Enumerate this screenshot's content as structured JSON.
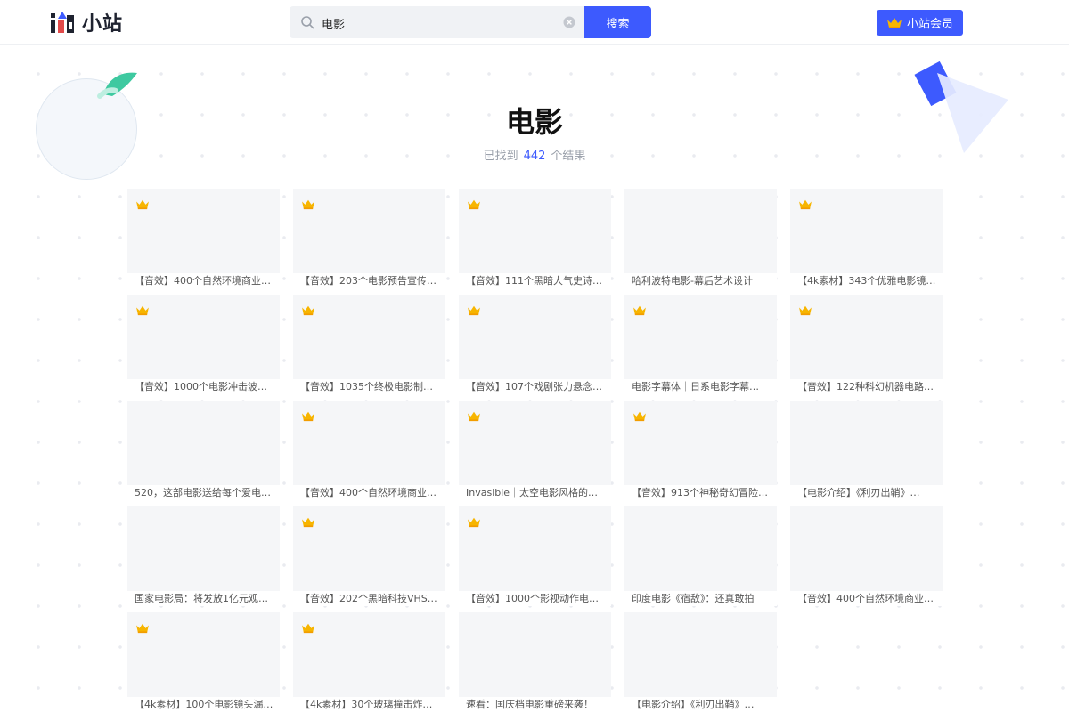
{
  "header": {
    "logo_text": "小站",
    "search": {
      "value": "电影",
      "placeholder": ""
    },
    "search_button": "搜索",
    "vip_button": "小站会员"
  },
  "page": {
    "title": "电影",
    "result_prefix": "已找到",
    "result_count": "442",
    "result_suffix": "个结果"
  },
  "colors": {
    "accent": "#3d5afe",
    "crown": "#f7b500",
    "teal": "#3ec9a0"
  },
  "icons": {
    "search": "search-icon",
    "clear": "clear-icon",
    "crown": "crown-icon"
  },
  "results": [
    {
      "title": "【音效】400个自然环境商业…",
      "vip": true
    },
    {
      "title": "【音效】203个电影预告宣传…",
      "vip": true
    },
    {
      "title": "【音效】111个黑暗大气史诗…",
      "vip": true
    },
    {
      "title": "哈利波特电影-幕后艺术设计",
      "vip": false
    },
    {
      "title": "【4k素材】343个优雅电影镜…",
      "vip": true
    },
    {
      "title": "【音效】1000个电影冲击波…",
      "vip": true
    },
    {
      "title": "【音效】1035个终极电影制…",
      "vip": true
    },
    {
      "title": "【音效】107个戏剧张力悬念…",
      "vip": true
    },
    {
      "title": "电影字幕体｜日系电影字幕…",
      "vip": true
    },
    {
      "title": "【音效】122种科幻机器电路…",
      "vip": true
    },
    {
      "title": "520，这部电影送给每个爱电…",
      "vip": false
    },
    {
      "title": "【音效】400个自然环境商业…",
      "vip": true
    },
    {
      "title": "Invasible｜太空电影风格的…",
      "vip": true
    },
    {
      "title": "【音效】913个神秘奇幻冒险…",
      "vip": true
    },
    {
      "title": "【电影介绍】《利刃出鞘》…",
      "vip": false
    },
    {
      "title": "国家电影局：将发放1亿元观…",
      "vip": false
    },
    {
      "title": "【音效】202个黑暗科技VHS…",
      "vip": true
    },
    {
      "title": "【音效】1000个影视动作电…",
      "vip": true
    },
    {
      "title": "印度电影《宿敌》：还真敢拍",
      "vip": false
    },
    {
      "title": "【音效】400个自然环境商业…",
      "vip": false
    },
    {
      "title": "【4k素材】100个电影镜头漏…",
      "vip": true
    },
    {
      "title": "【4k素材】30个玻璃撞击炸…",
      "vip": true
    },
    {
      "title": "速看：国庆档电影重磅来袭！",
      "vip": false
    },
    {
      "title": "【电影介绍】《利刃出鞘》…",
      "vip": false
    }
  ]
}
